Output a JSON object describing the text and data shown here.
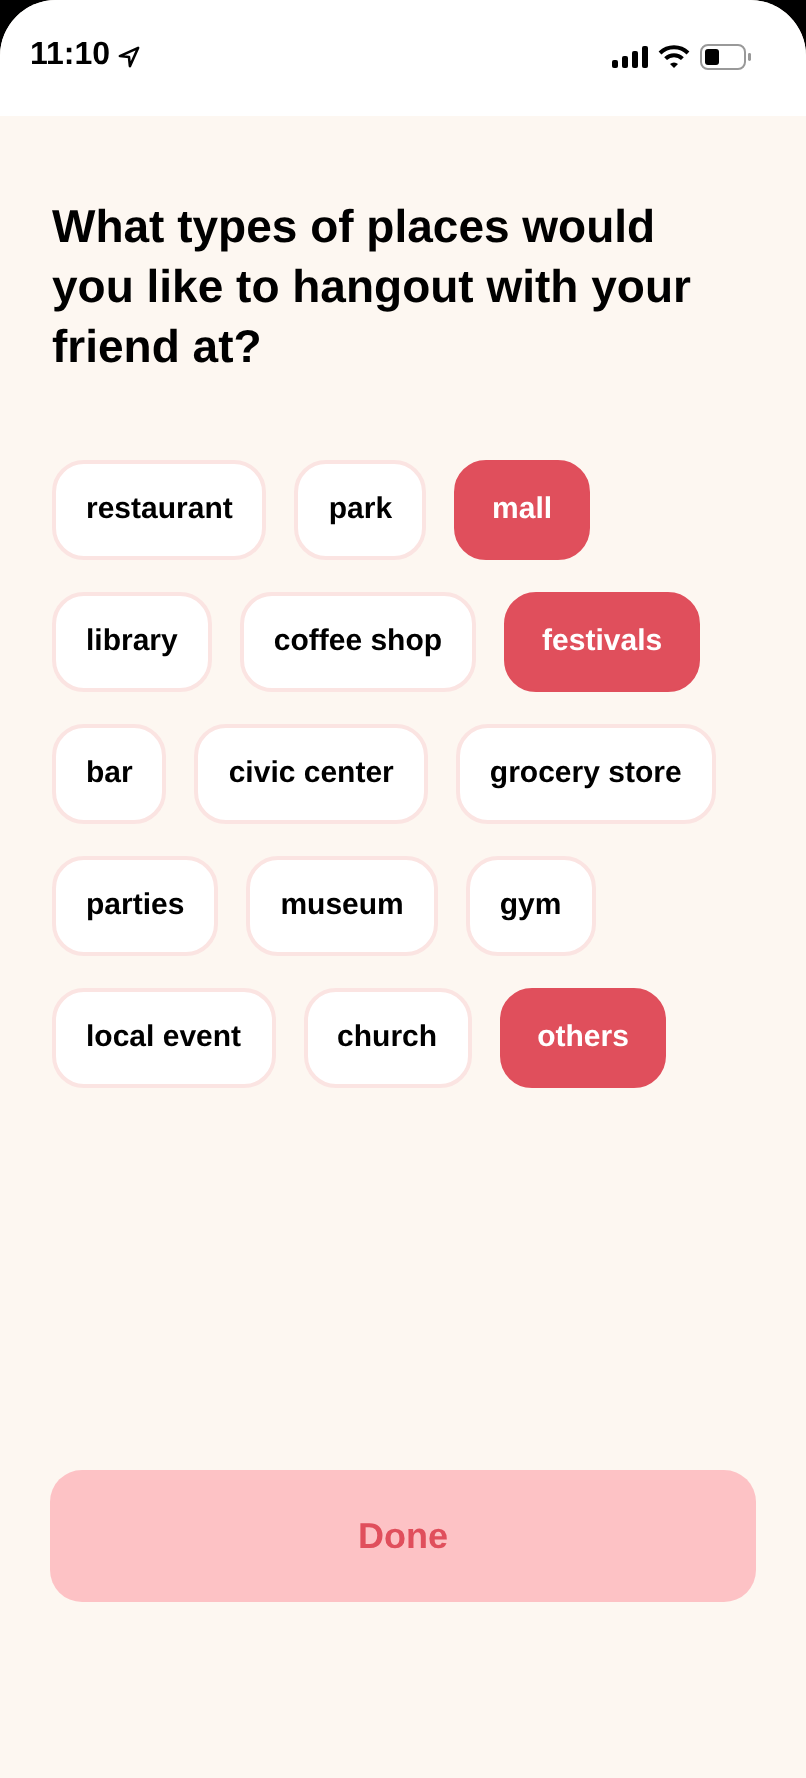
{
  "status_bar": {
    "time": "11:10"
  },
  "title": "What types of places would you like to hangout with your friend at?",
  "chip_rows": [
    {
      "chips": [
        {
          "label": "restaurant",
          "selected": false
        },
        {
          "label": "park",
          "selected": false
        },
        {
          "label": "mall",
          "selected": true
        }
      ]
    },
    {
      "chips": [
        {
          "label": "library",
          "selected": false
        },
        {
          "label": "coffee shop",
          "selected": false
        },
        {
          "label": "festivals",
          "selected": true
        }
      ]
    },
    {
      "chips": [
        {
          "label": "bar",
          "selected": false
        },
        {
          "label": "civic center",
          "selected": false
        },
        {
          "label": "grocery store",
          "selected": false
        }
      ]
    },
    {
      "chips": [
        {
          "label": "parties",
          "selected": false
        },
        {
          "label": "museum",
          "selected": false
        },
        {
          "label": "gym",
          "selected": false
        }
      ]
    },
    {
      "chips": [
        {
          "label": "local event",
          "selected": false
        },
        {
          "label": "church",
          "selected": false
        },
        {
          "label": "others",
          "selected": true
        }
      ]
    }
  ],
  "done_button": {
    "label": "Done",
    "disabled": true
  }
}
